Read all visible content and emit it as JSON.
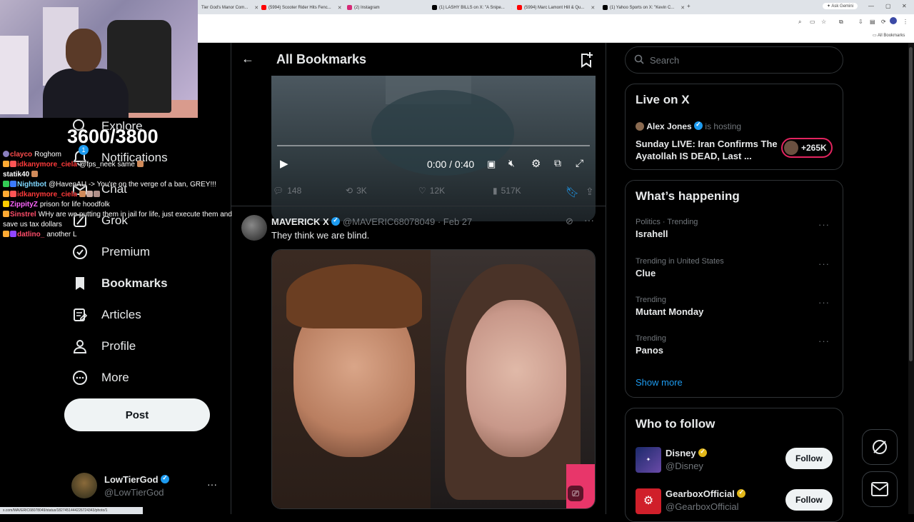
{
  "browser": {
    "tabs": [
      {
        "label": "Tier God's Manor Com...",
        "icon": "tab-favicon",
        "color": "#888888"
      },
      {
        "label": "(5994) Scooter Rider Hits Fenc...",
        "icon": "youtube-icon",
        "color": "#ff0000"
      },
      {
        "label": "(2) Instagram",
        "icon": "instagram-icon",
        "color": "#d62976"
      },
      {
        "label": "(1) LASHY BILLS on X: \"A Snipe...",
        "icon": "x-icon",
        "color": "#000000"
      },
      {
        "label": "(5994) Marc Lamont Hill & Qu...",
        "icon": "youtube-icon",
        "color": "#ff0000"
      },
      {
        "label": "(1) Yahoo Sports on X: \"Kevin C...",
        "icon": "x-icon",
        "color": "#000000"
      }
    ],
    "ask_gemini": "Ask Gemini",
    "all_bookmarks": "All Bookmarks",
    "status_url": "x.com/MAVERIC68078049/status/1827451444226724343/photo/1"
  },
  "stream": {
    "sub_count": "3600/3800",
    "chat": [
      {
        "user": "clayco",
        "message": "Roghom",
        "color": "#ff4d4d",
        "badge": "#8a7fbf"
      },
      {
        "user": "idkanymore_ciela",
        "message": "@fps_neek same",
        "color": "#ff3b3b",
        "badge": "#ffaa33"
      },
      {
        "user": "statik40",
        "message": "",
        "color": "#ffffff",
        "badge": ""
      },
      {
        "user": "Nightbot",
        "message": "@HavenAU -> You're on the verge of a ban, GREY!!!",
        "color": "#7fd7ff",
        "badge": "#33cc55"
      },
      {
        "user": "idkanymore_ciela",
        "message": "",
        "color": "#ff3b3b",
        "badge": "#ffaa33"
      },
      {
        "user": "ZippityZ",
        "message": "prison for life hoodfolk",
        "color": "#ff66ff",
        "badge": "#ffcc00"
      },
      {
        "user": "Sinstrel",
        "message": "WHy are we putting them in jail for life, just execute them and",
        "color": "#ff4d6a",
        "badge": "#ffaa33"
      },
      {
        "user": "",
        "message": "save us tax dollars",
        "color": "#ffffff",
        "badge": ""
      },
      {
        "user": "datlino_",
        "message": "another L",
        "color": "#ff4d6a",
        "badge": "#ffaa33"
      }
    ]
  },
  "nav": {
    "items": [
      {
        "label": "Explore",
        "icon": "search-icon"
      },
      {
        "label": "Notifications",
        "icon": "bell-icon",
        "badge": "1"
      },
      {
        "label": "Chat",
        "icon": "mail-icon"
      },
      {
        "label": "Grok",
        "icon": "grok-icon"
      },
      {
        "label": "Premium",
        "icon": "x-premium-icon"
      },
      {
        "label": "Bookmarks",
        "icon": "bookmark-icon"
      },
      {
        "label": "Articles",
        "icon": "article-icon"
      },
      {
        "label": "Profile",
        "icon": "person-icon"
      },
      {
        "label": "More",
        "icon": "more-circle-icon"
      }
    ],
    "post_label": "Post",
    "account": {
      "name": "LowTierGod",
      "handle": "@LowTierGod"
    }
  },
  "main": {
    "title": "All Bookmarks",
    "video": {
      "time": "0:00 / 0:40"
    },
    "tweet1_stats": {
      "replies": "148",
      "reposts": "3K",
      "likes": "12K",
      "views": "517K"
    },
    "tweet2": {
      "name": "MAVERICK X",
      "handle": "@MAVERIC68078049",
      "date": "· Feb 27",
      "text": "They think we are blind."
    }
  },
  "sidebar": {
    "search_placeholder": "Search",
    "live": {
      "title": "Live on X",
      "host": "Alex Jones",
      "hosting_label": "is hosting",
      "headline": "Sunday LIVE: Iran Confirms The Ayatollah IS DEAD, Last ...",
      "listeners": "+265K"
    },
    "happening": {
      "title": "What’s happening",
      "trends": [
        {
          "context": "Politics · Trending",
          "name": "Israhell"
        },
        {
          "context": "Trending in United States",
          "name": "Clue"
        },
        {
          "context": "Trending",
          "name": "Mutant Monday"
        },
        {
          "context": "Trending",
          "name": "Panos"
        }
      ],
      "show_more": "Show more"
    },
    "who_to_follow": {
      "title": "Who to follow",
      "accounts": [
        {
          "name": "Disney",
          "handle": "@Disney"
        },
        {
          "name": "GearboxOfficial",
          "handle": "@GearboxOfficial"
        }
      ],
      "follow_label": "Follow"
    }
  },
  "colors": {
    "accent": "#1d9bf0",
    "gold": "#e2b719",
    "background": "#000000",
    "border": "#2f3336"
  }
}
